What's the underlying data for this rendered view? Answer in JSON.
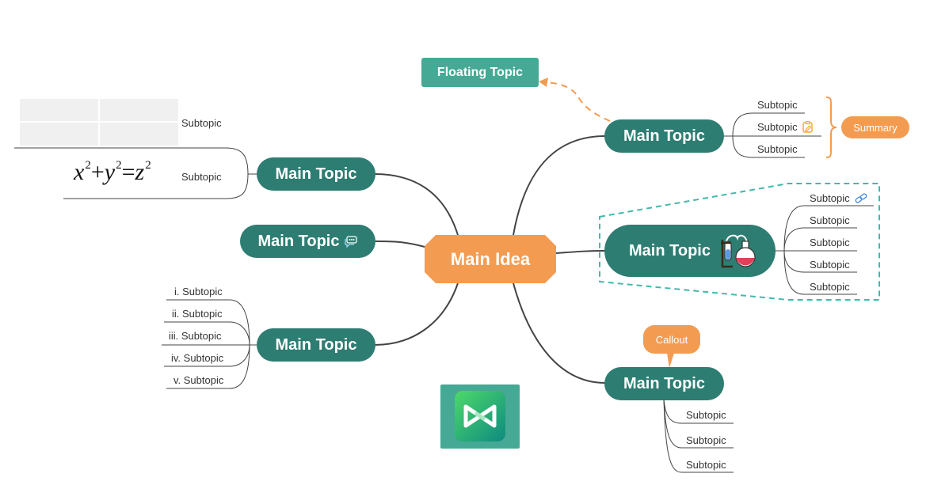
{
  "center": {
    "label": "Main Idea",
    "color": "#f39c51"
  },
  "floating_topic": {
    "label": "Floating Topic",
    "color": "#45a995"
  },
  "colors": {
    "main_topic": "#2e7d72",
    "accent_orange": "#f39c51",
    "boundary": "#45b8a8",
    "line": "#444444"
  },
  "topics": {
    "top_right": {
      "label": "Main Topic",
      "subtopics": [
        {
          "label": "Subtopic"
        },
        {
          "label": "Subtopic",
          "icon": "note-icon"
        },
        {
          "label": "Subtopic"
        }
      ],
      "summary": {
        "label": "Summary"
      }
    },
    "mid_right": {
      "label": "Main Topic",
      "icon": "chemistry-flask-icon",
      "subtopics": [
        {
          "label": "Subtopic",
          "icon": "link-icon"
        },
        {
          "label": "Subtopic"
        },
        {
          "label": "Subtopic"
        },
        {
          "label": "Subtopic"
        },
        {
          "label": "Subtopic"
        }
      ]
    },
    "bottom_right": {
      "label": "Main Topic",
      "callout": {
        "label": "Callout"
      },
      "subtopics": [
        {
          "label": "Subtopic"
        },
        {
          "label": "Subtopic"
        },
        {
          "label": "Subtopic"
        }
      ]
    },
    "top_left": {
      "label": "Main Topic",
      "subtopics": [
        {
          "label": "Subtopic",
          "attachment": "table"
        },
        {
          "label": "Subtopic",
          "attachment": "formula"
        }
      ],
      "formula": {
        "x": "x",
        "y": "y",
        "z": "z",
        "exp": "2",
        "plus": "+",
        "eq": "="
      }
    },
    "mid_left": {
      "label": "Main Topic",
      "icon": "comment-icon"
    },
    "bottom_left": {
      "label": "Main Topic",
      "subtopics": [
        {
          "label": "i. Subtopic"
        },
        {
          "label": "ii. Subtopic"
        },
        {
          "label": "iii. Subtopic"
        },
        {
          "label": "iv. Subtopic"
        },
        {
          "label": "v. Subtopic"
        }
      ]
    }
  },
  "logo": {
    "name": "mindmaster-logo"
  }
}
